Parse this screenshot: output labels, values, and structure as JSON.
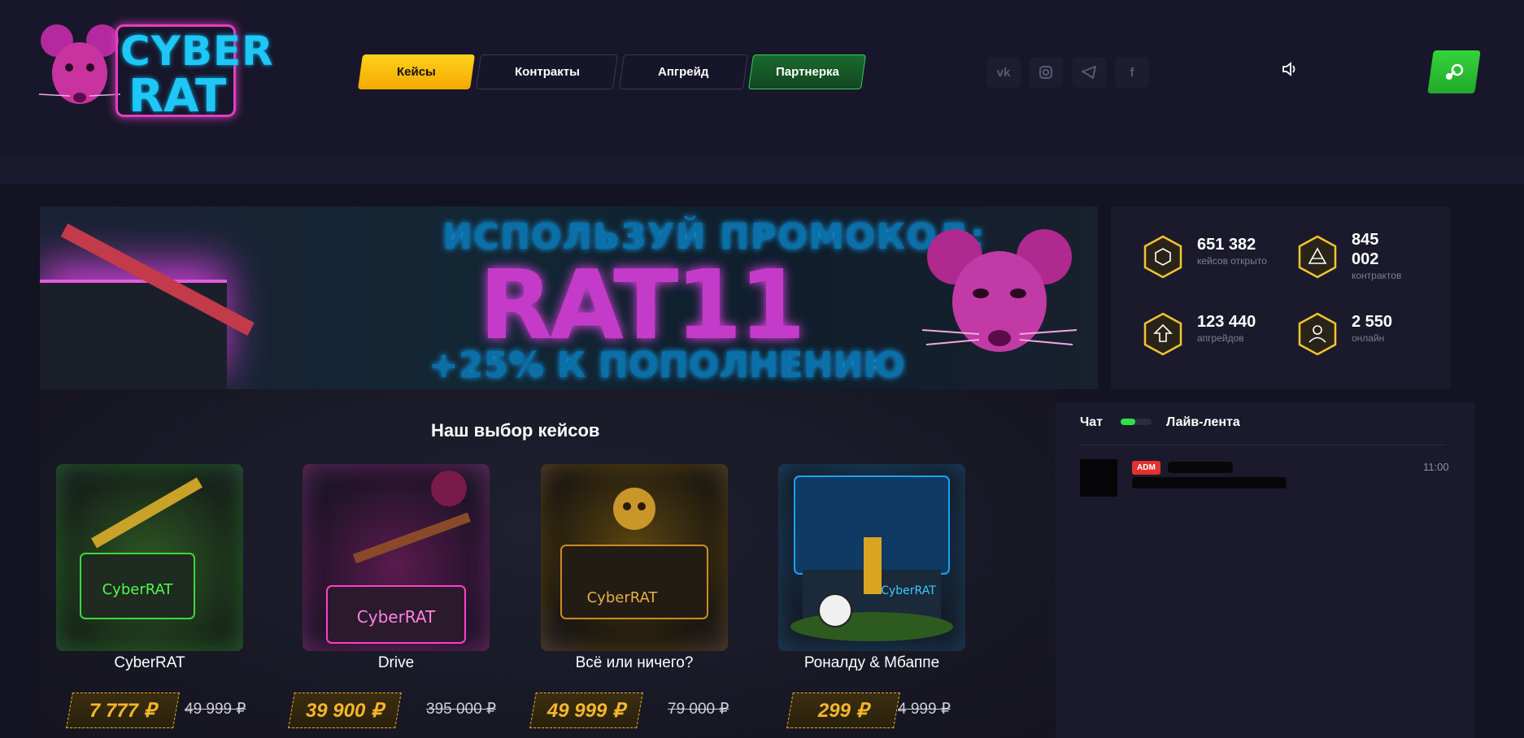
{
  "brand": {
    "line1": "CYBER",
    "line2": "RAT"
  },
  "nav": {
    "cases": "Кейсы",
    "contracts": "Контракты",
    "upgrade": "Апгрейд",
    "partner": "Партнерка"
  },
  "social": {
    "vk": "vk-icon",
    "instagram": "instagram-icon",
    "telegram": "telegram-icon",
    "facebook": "facebook-icon"
  },
  "banner": {
    "line1": "ИСПОЛЬЗУЙ ПРОМОКОД:",
    "code": "RAT11",
    "line3": "+25% К ПОПОЛНЕНИЮ"
  },
  "stats": [
    {
      "value": "651 382",
      "label": "кейсов открыто",
      "icon": "cube-icon"
    },
    {
      "value1": "845",
      "value2": "002",
      "label": "контрактов",
      "icon": "triangle-icon"
    },
    {
      "value": "123 440",
      "label": "апгрейдов",
      "icon": "arrow-up-icon"
    },
    {
      "value": "2 550",
      "label": "онлайн",
      "icon": "user-icon"
    }
  ],
  "cases_section": {
    "title": "Наш выбор кейсов",
    "items": [
      {
        "name": "CyberRAT",
        "price": "7 777 ₽",
        "old_price": "49 999 ₽",
        "accent": "#3cd93a"
      },
      {
        "name": "Drive",
        "price": "39 900 ₽",
        "old_price": "395 000 ₽",
        "accent": "#ff3fc9"
      },
      {
        "name": "Всё или ничего?",
        "price": "49 999 ₽",
        "old_price": "79 000 ₽",
        "accent": "#e0a020"
      },
      {
        "name": "Роналду & Мбаппе",
        "price": "299 ₽",
        "old_price": "4 999 ₽",
        "accent": "#1ea0f0"
      }
    ]
  },
  "chat": {
    "tab_chat": "Чат",
    "tab_live": "Лайв-лента",
    "message": {
      "badge": "ADM",
      "time": "11:00"
    }
  },
  "colors": {
    "accent_yellow": "#ffd21a",
    "accent_green": "#32d15a",
    "brand_pink": "#e33fc0",
    "brand_blue": "#1ec7f5"
  }
}
